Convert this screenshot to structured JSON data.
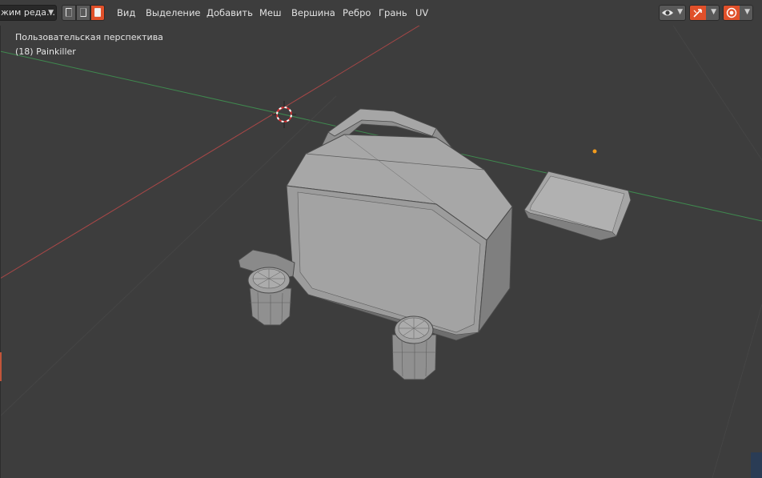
{
  "header": {
    "mode_label": "жим реда…",
    "menus": [
      "Вид",
      "Выделение",
      "Добавить",
      "Меш",
      "Вершина",
      "Ребро",
      "Грань",
      "UV"
    ]
  },
  "viewport": {
    "perspective_label": "Пользовательская перспектива",
    "object_label": "(18) Painkiller"
  },
  "icons": {
    "mode_dropdown": "chevron-down-icon",
    "select_vertex": "vertex-select-icon",
    "select_edge": "edge-select-icon",
    "select_face": "face-select-icon",
    "visibility": "eye-icon",
    "gizmo": "gizmo-arrow-icon",
    "overlays": "overlay-sphere-icon"
  },
  "colors": {
    "background": "#3d3d3d",
    "x_axis": "#b24a4a",
    "y_axis": "#4e8f4e",
    "accent": "#e0502a",
    "mesh": "#9a9a9a"
  }
}
